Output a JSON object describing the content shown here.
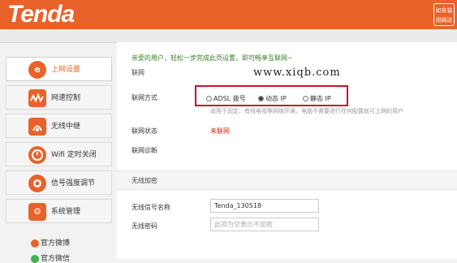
{
  "header": {
    "logo": "Tenda",
    "help_line1": "如安装",
    "help_line2": "用网达"
  },
  "sidebar": {
    "items": [
      {
        "label": "上网设置",
        "icon": "internet-explorer-icon",
        "active": true
      },
      {
        "label": "网速控制",
        "icon": "speed-wave-icon",
        "active": false
      },
      {
        "label": "无线中继",
        "icon": "wireless-relay-icon",
        "active": false
      },
      {
        "label": "Wifi 定时关闭",
        "icon": "wifi-timer-icon",
        "active": false
      },
      {
        "label": "信号强度调节",
        "icon": "signal-strength-icon",
        "active": false
      },
      {
        "label": "系统管理",
        "icon": "system-gear-icon",
        "active": false
      }
    ],
    "social": {
      "weibo": "官方微博",
      "wechat": "官方微信"
    }
  },
  "main": {
    "greeting": "亲爱的用户，轻松一步完成此页设置，即可畅享互联网~",
    "section_title": "联网",
    "watermark": "www.xiqb.com",
    "connection_mode": {
      "label": "联网方式",
      "options": [
        "ADSL 拨号",
        "动态 IP",
        "静态 IP"
      ],
      "selected": "动态 IP",
      "hint": "适用于固定、有线电视等网络环境，电脑不需要进行任何配置就可上网的用户"
    },
    "status": {
      "label": "联网状态",
      "value": "未联网"
    },
    "diagnosis_label": "联网诊断",
    "wireless_section_title": "无线加密",
    "ssid": {
      "label": "无线信号名称",
      "value": "Tenda_130518"
    },
    "password": {
      "label": "无线密码",
      "placeholder": "此项为空表示不加密"
    }
  },
  "colors": {
    "brand": "#e8622a",
    "highlight_box": "#c8102e",
    "status_error": "#d81e06",
    "greeting": "#3a7d2a"
  }
}
